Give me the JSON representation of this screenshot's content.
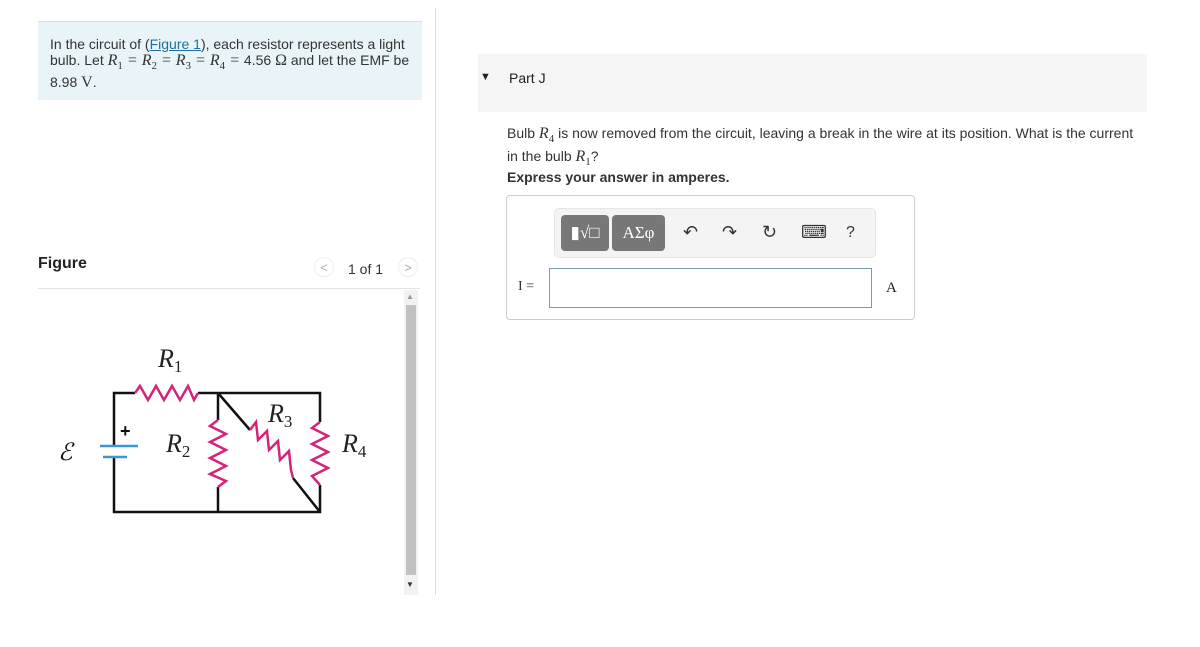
{
  "intro": {
    "prefix": "In the circuit of (",
    "link": "Figure 1",
    "mid": "), each resistor represents a light bulb. Let ",
    "r": "R",
    "s1": "1",
    "s2": "2",
    "s3": "3",
    "s4": "4",
    "eq": " = ",
    "value": "4.56",
    "ohm": "Ω",
    "and": " and let the EMF be ",
    "emf": "8.98",
    "volt": "V",
    "end": "."
  },
  "figure": {
    "label": "Figure",
    "pager": "1 of 1",
    "prev": "<",
    "next": ">",
    "circuit": {
      "emf": "ℰ",
      "plus": "+",
      "r": "R",
      "s1": "1",
      "s2": "2",
      "s3": "3",
      "s4": "4",
      "resistor_color": "#d4237a"
    }
  },
  "part": {
    "caret": "▼",
    "title": "Part J",
    "q1": "Bulb ",
    "r": "R",
    "s4": "4",
    "q2": " is now removed from the circuit, leaving a break in the wire at its position. What is the current in the bulb ",
    "s1": "1",
    "q3": "?",
    "express": "Express your answer in amperes.",
    "toolbar": {
      "templates": "▮√□",
      "symbols": "ΑΣφ",
      "undo": "↶",
      "redo": "↷",
      "reset": "↻",
      "keyboard": "⌨",
      "help": "?"
    },
    "input_label": "I =",
    "input_value": "",
    "unit": "A"
  }
}
